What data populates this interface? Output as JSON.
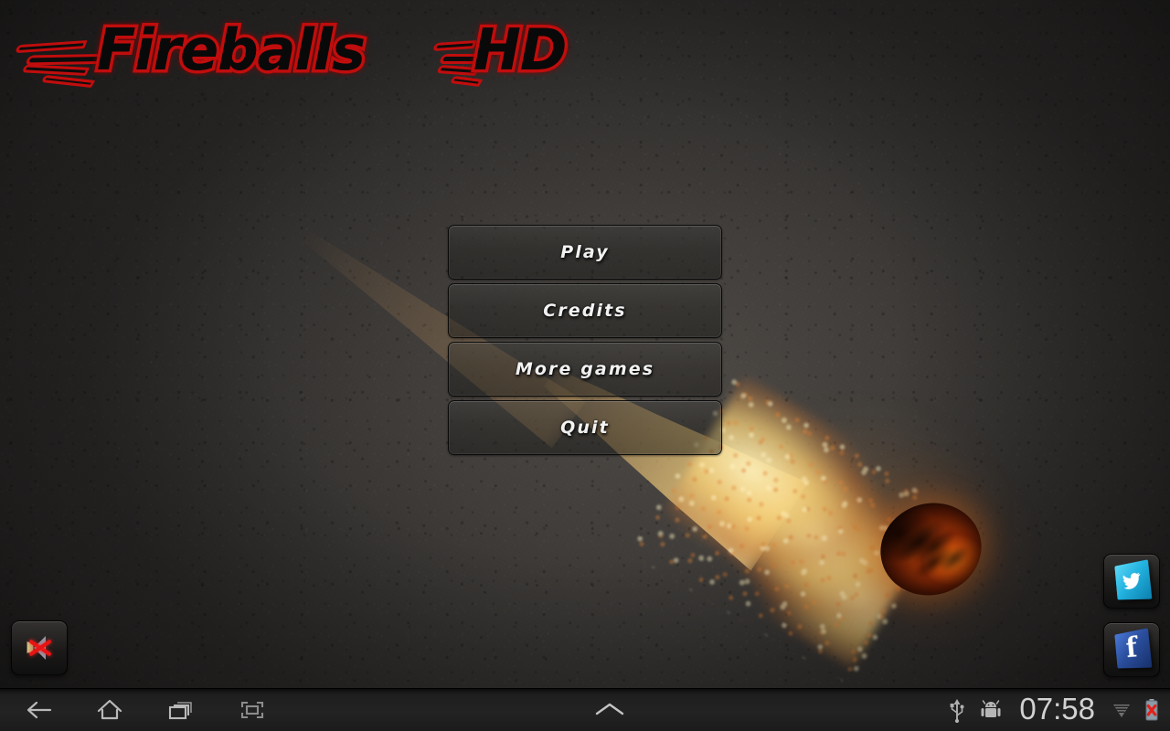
{
  "game": {
    "title_main": "Fireballs",
    "title_suffix": "HD",
    "logo_name": "fireballs-hd-logo"
  },
  "menu": {
    "items": [
      {
        "label": "Play",
        "name": "play-button"
      },
      {
        "label": "Credits",
        "name": "credits-button"
      },
      {
        "label": "More games",
        "name": "more-games-button"
      },
      {
        "label": "Quit",
        "name": "quit-button"
      }
    ]
  },
  "corner_buttons": {
    "mute": {
      "label": "Sound muted",
      "icon": "speaker-muted-icon",
      "state": "muted"
    },
    "twitter": {
      "label": "Twitter",
      "icon": "twitter-icon"
    },
    "facebook": {
      "label": "Facebook",
      "icon": "facebook-icon",
      "glyph": "f"
    }
  },
  "colors": {
    "logo_outline": "#c00d0d",
    "logo_fill": "#0a0a0a",
    "button_text": "#f4f4f4",
    "mute_slash": "#e81414",
    "twitter_tile": "#23b3e0",
    "facebook_tile": "#2b4f9e",
    "fireball_core": "#e06010",
    "background": "#302e2c"
  },
  "navbar": {
    "back_icon": "back-arrow-icon",
    "home_icon": "home-icon",
    "recents_icon": "recent-apps-icon",
    "screenshot_icon": "screenshot-icon",
    "expand_icon": "chevron-up-icon",
    "usb_icon": "usb-icon",
    "android_icon": "android-robot-icon",
    "clock": "07:58",
    "wifi_icon": "wifi-signal-icon",
    "battery_icon": "battery-error-icon"
  }
}
